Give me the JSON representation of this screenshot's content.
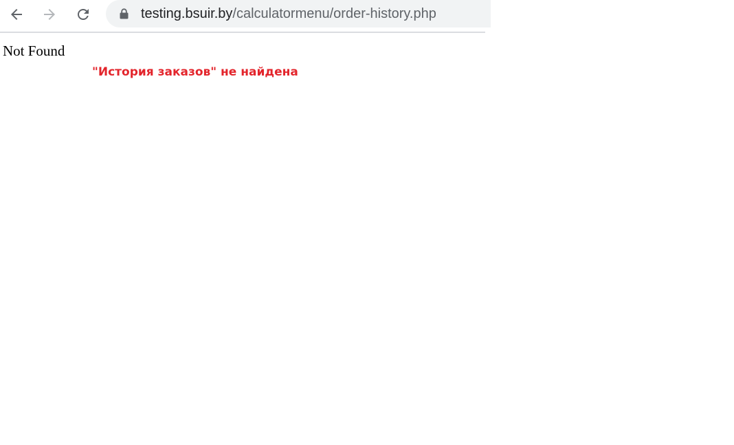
{
  "browser": {
    "url": {
      "host": "testing.bsuir.by",
      "path": "/calculatormenu/order-history.php"
    },
    "icons": {
      "back": "arrow-left-icon",
      "forward": "arrow-right-icon",
      "reload": "reload-icon",
      "security": "lock-icon"
    }
  },
  "page": {
    "heading": "Not Found",
    "message": "\"История заказов\" не найдена"
  },
  "colors": {
    "message": "#e3252c",
    "omnibox_background": "#f1f3f4",
    "icon": "#5f6368",
    "icon_disabled": "#b4b7ba"
  }
}
